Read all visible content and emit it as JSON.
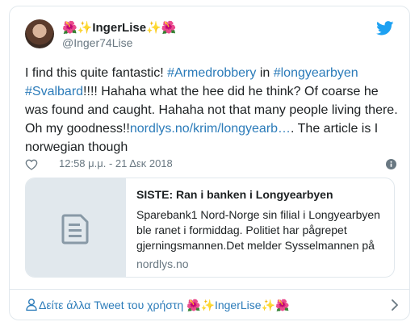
{
  "author": {
    "display_name": "🌺✨IngerLise✨🌺",
    "username": "@Inger74Lise"
  },
  "tweet": {
    "text_parts": [
      {
        "text": "I find this quite fantastic! ",
        "link": false
      },
      {
        "text": "#Armedrobbery",
        "link": true
      },
      {
        "text": " in ",
        "link": false
      },
      {
        "text": "#longyearbyen",
        "link": true
      },
      {
        "text": " ",
        "link": false
      },
      {
        "text": "#Svalbard",
        "link": true
      },
      {
        "text": "!!!! Hahaha what the hee did he think? Of coarse he was found and caught. Hahaha not that many people living there. Oh my goodness!!",
        "link": false
      },
      {
        "text": "nordlys.no/krim/longyearb…",
        "link": true
      },
      {
        "text": ". The article is I norwegian though",
        "link": false
      }
    ],
    "timestamp": "12:58 μ.μ. - 21 Δεκ 2018"
  },
  "link_card": {
    "title": "SISTE: Ran i banken i Longyearbyen",
    "description": "Sparebank1 Nord-Norge sin filial i Longyearbyen ble ranet i formiddag. Politiet har pågrepet gjerningsmannen.Det melder Sysselmannen på",
    "domain": "nordlys.no"
  },
  "footer": {
    "text": "Δείτε άλλα Tweet του χρήστη 🌺✨IngerLise✨🌺"
  },
  "colors": {
    "link": "#2b7bb9",
    "muted": "#697882",
    "border": "#e1e8ed",
    "twitter_blue": "#1da1f2"
  },
  "icons": [
    "twitter-bird-icon",
    "heart-icon",
    "info-icon",
    "document-icon",
    "user-icon",
    "chevron-right-icon"
  ]
}
